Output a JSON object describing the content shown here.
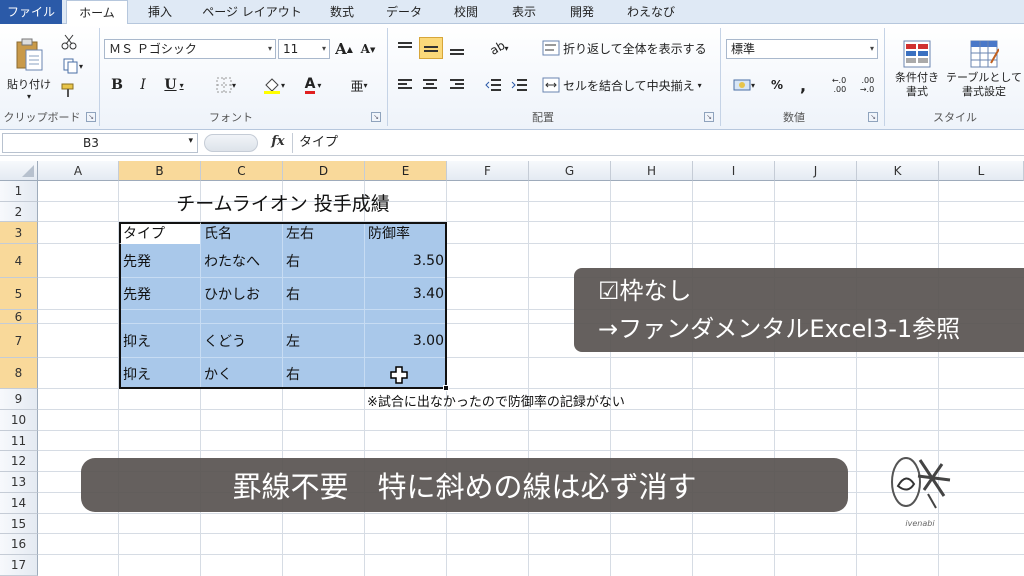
{
  "ribbon_tabs": [
    "ファイル",
    "ホーム",
    "挿入",
    "ページ レイアウト",
    "数式",
    "データ",
    "校閲",
    "表示",
    "開発",
    "わえなび"
  ],
  "ribbon": {
    "clipboard": {
      "paste_label": "貼り付け",
      "group_label": "クリップボード"
    },
    "font": {
      "font_name": "ＭＳ Ｐゴシック",
      "font_size": "11",
      "grow": "A",
      "shrink": "A",
      "bold": "B",
      "italic": "I",
      "underline": "U",
      "group_label": "フォント"
    },
    "alignment": {
      "wrap_text": "折り返して全体を表示する",
      "merge_center": "セルを結合して中央揃え",
      "group_label": "配置"
    },
    "number": {
      "format": "標準",
      "percent": "%",
      "comma": ",",
      "inc_decimal": "←.0\n.00",
      "dec_decimal": ".00\n→.0",
      "group_label": "数値"
    },
    "styles": {
      "conditional": "条件付き\n書式",
      "table": "テーブルとして\n書式設定",
      "group_label": "スタイル"
    }
  },
  "formula_bar": {
    "name_box": "B3",
    "fx": "fx",
    "content": "タイプ"
  },
  "columns": [
    "A",
    "B",
    "C",
    "D",
    "E",
    "F",
    "G",
    "H",
    "I",
    "J",
    "K",
    "L"
  ],
  "rows": [
    "1",
    "2",
    "3",
    "4",
    "5",
    "6",
    "7",
    "8",
    "9",
    "10",
    "11",
    "12",
    "13",
    "14",
    "15",
    "16",
    "17"
  ],
  "sheet": {
    "title": "チームライオン 投手成績",
    "headers": [
      "タイプ",
      "氏名",
      "左右",
      "防御率"
    ],
    "records": [
      [
        "先発",
        "わたなへ",
        "右",
        "3.50"
      ],
      [
        "先発",
        "ひかしお",
        "右",
        "3.40"
      ],
      [
        "",
        "",
        "",
        ""
      ],
      [
        "抑え",
        "くどう",
        "左",
        "3.00"
      ],
      [
        "抑え",
        "かく",
        "右",
        ""
      ]
    ],
    "note": "※試合に出なかったので防御率の記録がない"
  },
  "overlay_right": {
    "line1": "☑枠なし",
    "line2": "→ファンダメンタルExcel3-1参照"
  },
  "overlay_bottom": "罫線不要　特に斜めの線は必ず消す",
  "logo_text": "ivenabi",
  "colors": {
    "selection": "#a9c8ea",
    "accent": "#2b5aa8",
    "overlay": "#585250"
  }
}
